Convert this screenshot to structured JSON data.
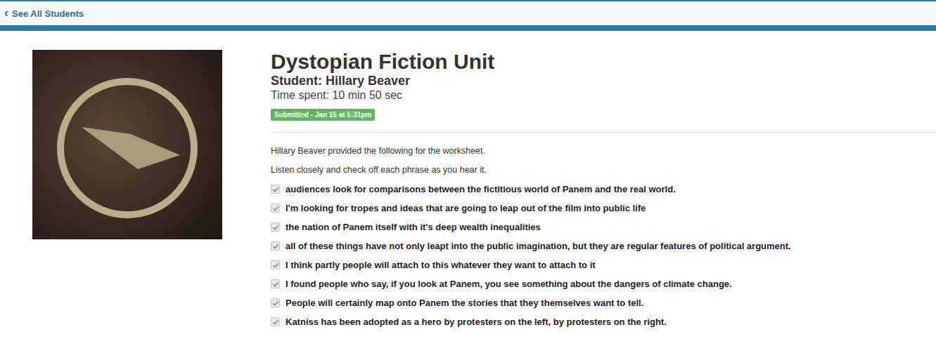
{
  "nav": {
    "back_icon": "‹",
    "back_label": "See All Students"
  },
  "assignment": {
    "title": "Dystopian Fiction Unit",
    "student": "Student: Hillary Beaver",
    "time_spent": "Time spent: 10 min 50 sec",
    "badge": "Submitted - Jan 15 at 5:31pm"
  },
  "worksheet": {
    "intro": "Hillary Beaver provided the following for the worksheet.",
    "instruction": "Listen closely and check off each phrase as you hear it.",
    "items": [
      {
        "text": "audiences look for comparisons between the fictitious world of Panem and the real world.",
        "checked": true
      },
      {
        "text": "I'm looking for tropes and ideas that are going to leap out of the film into public life",
        "checked": true
      },
      {
        "text": "the nation of Panem itself with it's deep wealth inequalities",
        "checked": true
      },
      {
        "text": "all of these things have not only leapt into the public imagination, but they are regular features of political argument.",
        "checked": true
      },
      {
        "text": "I think partly people will attach to this whatever they want to attach to it",
        "checked": true
      },
      {
        "text": "I found people who say, if you look at Panem, you see something about the dangers of climate change.",
        "checked": true
      },
      {
        "text": "People will certainly map onto Panem the stories that they themselves want to tell.",
        "checked": true
      },
      {
        "text": "Katniss has been adopted as a hero by protesters on the left, by protesters on the right.",
        "checked": true
      }
    ]
  }
}
